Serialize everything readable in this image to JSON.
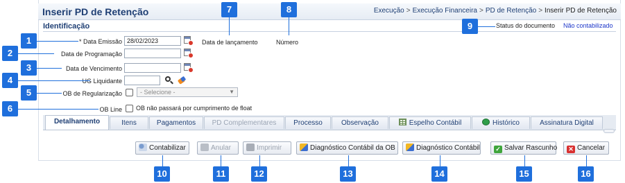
{
  "header": {
    "title": "Inserir PD de Retenção",
    "breadcrumb": [
      "Execução",
      "Execução Financeira",
      "PD de Retenção",
      "Inserir PD de Retenção"
    ]
  },
  "section": {
    "title": "Identificação"
  },
  "form": {
    "data_emissao": {
      "label": "* Data Emissão",
      "value": "28/02/2023"
    },
    "data_programacao": {
      "label": "Data de Programação",
      "value": ""
    },
    "data_vencimento": {
      "label": "Data de Vencimento",
      "value": ""
    },
    "ug_liquidante": {
      "label": "UG Liquidante",
      "value": ""
    },
    "ob_regularizacao": {
      "label": "OB de Regularização",
      "select_value": "- Selecione -"
    },
    "ob_line": {
      "label": "OB Line",
      "checkbox_text": "OB não passará por cumprimento de float"
    }
  },
  "info": {
    "data_lancamento_label": "Data de lançamento",
    "numero_label": "Número",
    "status_label": "Status do documento",
    "status_value": "Não contabilizado"
  },
  "tabs": [
    {
      "label": "Detalhamento",
      "state": "active"
    },
    {
      "label": "Itens",
      "state": "normal"
    },
    {
      "label": "Pagamentos",
      "state": "normal"
    },
    {
      "label": "PD Complementares",
      "state": "disabled"
    },
    {
      "label": "Processo",
      "state": "normal"
    },
    {
      "label": "Observação",
      "state": "normal"
    },
    {
      "label": "Espelho Contábil",
      "state": "normal",
      "icon": "spreadsheet-icon"
    },
    {
      "label": "Histórico",
      "state": "normal",
      "icon": "history-icon"
    },
    {
      "label": "Assinatura Digital",
      "state": "normal"
    }
  ],
  "buttons": {
    "contabilizar": "Contabilizar",
    "anular": "Anular",
    "imprimir": "Imprimir",
    "diag_ob": "Diagnóstico Contábil da OB",
    "diag": "Diagnóstico Contábil",
    "salvar": "Salvar Rascunho",
    "cancelar": "Cancelar"
  },
  "callouts": [
    "1",
    "2",
    "3",
    "4",
    "5",
    "6",
    "7",
    "8",
    "9",
    "10",
    "11",
    "12",
    "13",
    "14",
    "15",
    "16"
  ],
  "colors": {
    "callout": "#1f6fdc",
    "title": "#1f3f74",
    "status_link": "#1a34c9"
  }
}
